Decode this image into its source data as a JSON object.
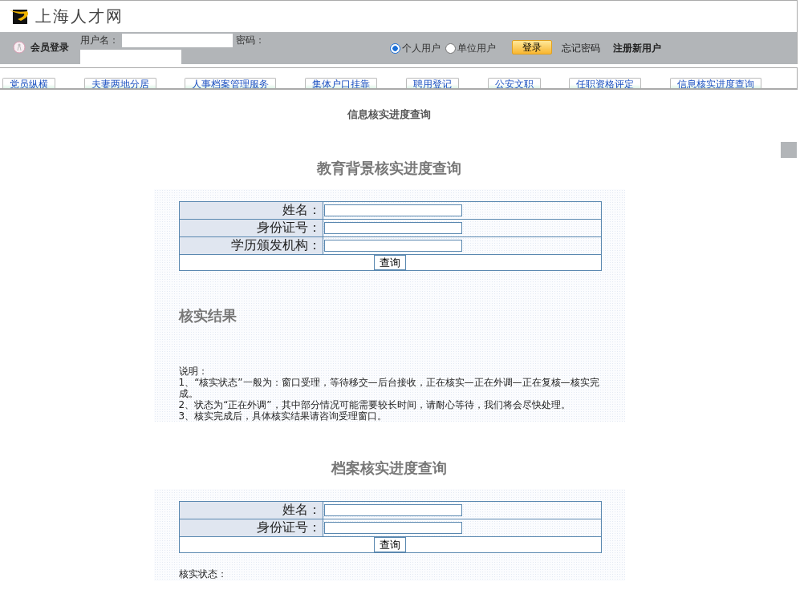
{
  "site": {
    "title": "上海人才网"
  },
  "login": {
    "heading": "会员登录",
    "username_label": "用户名：",
    "password_label": "密码：",
    "user_types": [
      {
        "label": "个人用户",
        "selected": true
      },
      {
        "label": "单位用户",
        "selected": false
      }
    ],
    "login_button": "登录",
    "links": [
      "忘记密码",
      "注册新用户"
    ]
  },
  "nav": [
    "党员纵横",
    "夫妻两地分居",
    "人事档案管理服务",
    "集体户口挂靠",
    "聘用登记",
    "公安文职",
    "任职资格评定",
    "信息核实进度查询"
  ],
  "page_title": "信息核实进度查询",
  "sections": [
    {
      "title": "教育背景核实进度查询",
      "fields": [
        {
          "label": "姓名："
        },
        {
          "label": "身份证号："
        },
        {
          "label": "学历颁发机构："
        }
      ],
      "button": "查询",
      "result_heading": "核实结果",
      "notes": [
        "说明：",
        "1、“核实状态”一般为：窗口受理，等待移交—后台接收，正在核实—正在外调—正在复核—核实完成。",
        "2、状态为“正在外调”，其中部分情况可能需要较长时间，请耐心等待，我们将会尽快处理。",
        "3、核实完成后，具体核实结果请咨询受理窗口。"
      ]
    },
    {
      "title": "档案核实进度查询",
      "fields": [
        {
          "label": "姓名："
        },
        {
          "label": "身份证号："
        }
      ],
      "button": "查询",
      "status_label": "核实状态："
    }
  ]
}
